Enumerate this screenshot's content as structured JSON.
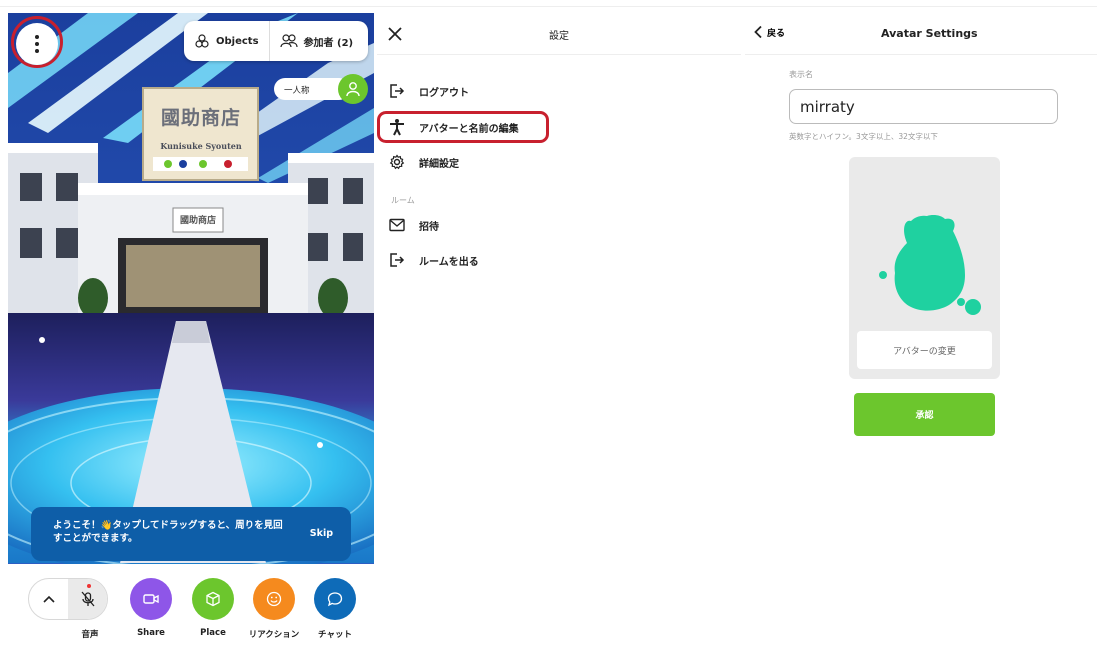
{
  "scene": {
    "objects_label": "Objects",
    "participants_label": "参加者 (2)",
    "persona_label": "一人称",
    "store_sign": "國助商店",
    "store_sign_romaji": "Kunisuke Syouten",
    "entrance_sign": "國助商店",
    "welcome_text": "ようこそ！👋タップしてドラッグすると、周りを見回すことができます。",
    "skip_label": "Skip",
    "bottom": {
      "voice_label": "音声",
      "share_label": "Share",
      "place_label": "Place",
      "reaction_label": "リアクション",
      "chat_label": "チャット"
    },
    "colors": {
      "share": "#8e56e8",
      "place": "#6cc62d",
      "reaction": "#f58a1e",
      "chat": "#0e6bb8"
    }
  },
  "settings": {
    "title": "設定",
    "items": [
      {
        "label": "ログアウト",
        "icon": "logout-icon"
      },
      {
        "label": "アバターと名前の編集",
        "icon": "person-icon"
      },
      {
        "label": "詳細設定",
        "icon": "gear-icon"
      }
    ],
    "section_room": "ルーム",
    "room_items": [
      {
        "label": "招待",
        "icon": "mail-icon"
      },
      {
        "label": "ルームを出る",
        "icon": "exit-icon"
      }
    ]
  },
  "avatar": {
    "back_label": "戻る",
    "title": "Avatar Settings",
    "display_name_label": "表示名",
    "display_name_value": "mirraty",
    "hint": "英数字とハイフン。3文字以上、32文字以下",
    "change_label": "アバターの変更",
    "confirm_label": "承認",
    "avatar_color": "#1fd1a0"
  }
}
